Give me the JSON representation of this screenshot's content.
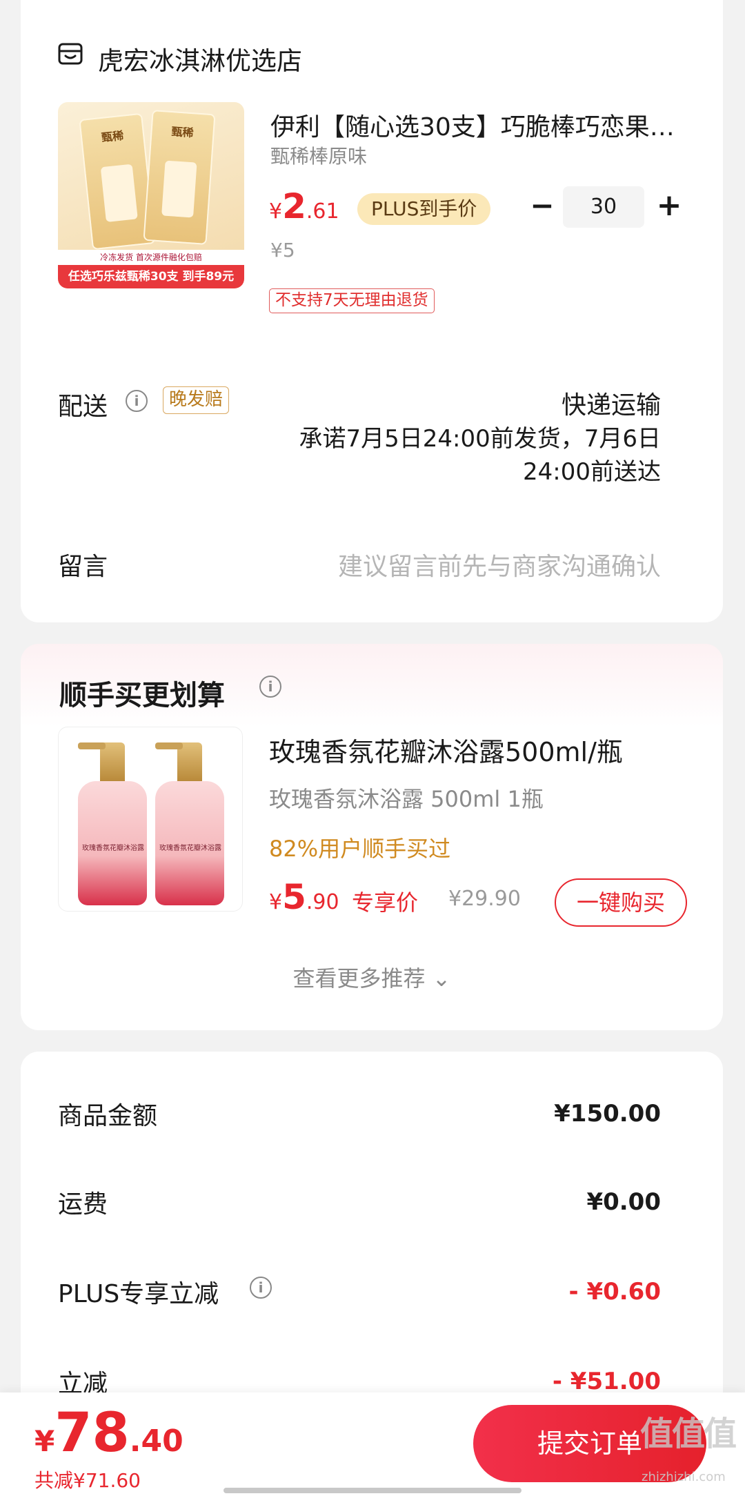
{
  "store": {
    "name": "虎宏冰淇淋优选店",
    "product": {
      "title": "伊利【随心选30支】巧脆棒巧恋果…",
      "spec": "甄稀棒原味",
      "price_symbol": "¥",
      "price_int": "2",
      "price_dec": ".61",
      "plus_tag": "PLUS到手价",
      "orig_price": "¥5",
      "quantity": "30",
      "qty_minus": "−",
      "qty_plus": "+",
      "return_policy": "不支持7天无理由退货",
      "image_brand": "甄稀",
      "image_strip": "冷冻发货 首次源件融化包赔",
      "image_banner": "任选巧乐兹甄稀30支 到手89元"
    },
    "delivery": {
      "label": "配送",
      "late_tag": "晚发赔",
      "method": "快递运输",
      "promise": "承诺7月5日24:00前发货，7月6日24:00前送达"
    },
    "message": {
      "label": "留言",
      "placeholder": "建议留言前先与商家沟通确认"
    }
  },
  "recommend": {
    "title": "顺手买更划算",
    "item": {
      "name": "玫瑰香氛花瓣沐浴露500ml/瓶",
      "spec": "玫瑰香氛沐浴露 500ml 1瓶",
      "social": "82%用户顺手买过",
      "price_symbol": "¥",
      "price_int": "5",
      "price_dec": ".90",
      "exclusive": "专享价",
      "orig_price": "¥29.90",
      "buy_label": "一键购买",
      "bottle_label": "玫瑰香氛花瓣沐浴露"
    },
    "more": "查看更多推荐 ⌄"
  },
  "summary": {
    "rows": [
      {
        "label": "商品金额",
        "value": "¥150.00"
      },
      {
        "label": "运费",
        "value": "¥0.00"
      },
      {
        "label": "PLUS专享立减",
        "value": "- ¥0.60"
      },
      {
        "label": "立减",
        "value": "- ¥51.00"
      }
    ]
  },
  "footer": {
    "total_symbol": "¥",
    "total_int": "78",
    "total_dec": ".40",
    "saved": "共减¥71.60",
    "submit": "提交订单",
    "watermark": "值值值",
    "watermark_sub": "zhizhizhi.com"
  },
  "colors": {
    "accent": "#e8262e",
    "plus_gold": "#fbe8b8",
    "social_orange": "#d08a20"
  },
  "icons": [
    "store-icon",
    "info-icon",
    "chevron-down-icon"
  ]
}
